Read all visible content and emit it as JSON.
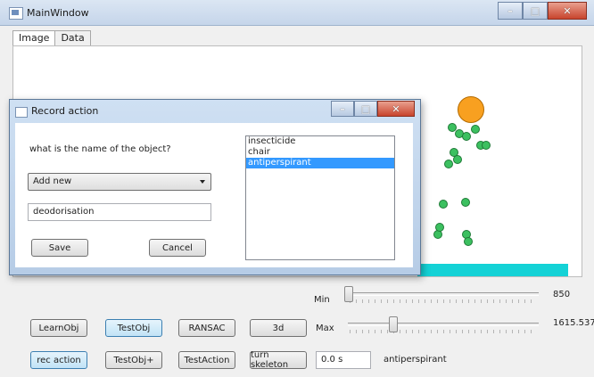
{
  "window": {
    "title": "MainWindow"
  },
  "tabs": [
    {
      "label": "Image"
    },
    {
      "label": "Data"
    }
  ],
  "sliders": {
    "min": {
      "label": "Min",
      "value": "850"
    },
    "max": {
      "label": "Max",
      "value": "1615.5378"
    }
  },
  "buttons": {
    "learn_obj": "LearnObj",
    "test_obj": "TestObj",
    "ransac": "RANSAC",
    "three_d": "3d",
    "rec_action": "rec action",
    "test_obj_plus": "TestObj+",
    "test_action": "TestAction",
    "turn_skeleton": "turn skeleton"
  },
  "time_field": {
    "value": "0.0 s"
  },
  "status_text": "antiperspirant",
  "dialog": {
    "title": "Record action",
    "prompt": "what is the name of the object?",
    "combo_value": "Add new",
    "name_input": "deodorisation",
    "save_label": "Save",
    "cancel_label": "Cancel",
    "list_items": [
      {
        "label": "insecticide",
        "selected": false
      },
      {
        "label": "chair",
        "selected": false
      },
      {
        "label": "antiperspirant",
        "selected": true
      }
    ]
  },
  "colors": {
    "accent": "#3399ff",
    "floor": "#14d2d6",
    "orange": "#f8a020",
    "green": "#3cc060"
  }
}
